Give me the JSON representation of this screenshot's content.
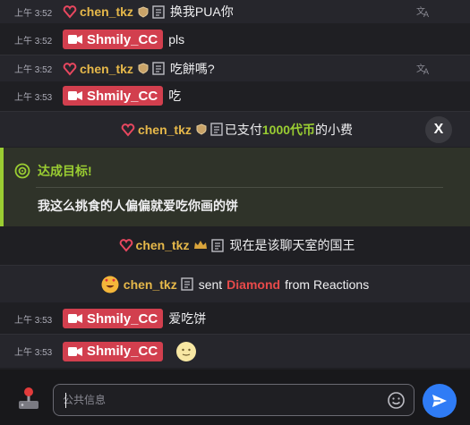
{
  "colors": {
    "accent_green": "#9acd32",
    "streamer_red": "#d23f4e",
    "send_blue": "#2f7cf6",
    "diamond_red": "#e84a4a",
    "coin_green": "#9acd32"
  },
  "messages": [
    {
      "time": "上午 3:52",
      "user": "chen_tkz",
      "text": "换我PUA你",
      "translate_icon": "translate-icon"
    },
    {
      "time": "上午 3:52",
      "user": "Shmily_CC",
      "text": "pls"
    },
    {
      "time": "上午 3:52",
      "user": "chen_tkz",
      "text": "吃餅嗎?",
      "translate_icon": "translate-icon"
    },
    {
      "time": "上午 3:53",
      "user": "Shmily_CC",
      "text": "吃"
    }
  ],
  "paid": {
    "user": "chen_tkz",
    "prefix": "已支付",
    "amount": "1000代币",
    "suffix": "的小费",
    "close_label": "X"
  },
  "goal": {
    "title": "达成目标!",
    "text": "我这么挑食的人偏偏就爱吃你画的饼"
  },
  "king": {
    "user": "chen_tkz",
    "text": "现在是该聊天室的国王"
  },
  "gift": {
    "user": "chen_tkz",
    "pre": "sent",
    "item": "Diamond",
    "post": "from Reactions"
  },
  "later": [
    {
      "time": "上午 3:53",
      "user": "Shmily_CC",
      "text": "爱吃饼"
    },
    {
      "time": "上午 3:53",
      "user": "Shmily_CC",
      "emoji": "smile-emoji"
    }
  ],
  "input": {
    "placeholder": "公共信息"
  }
}
